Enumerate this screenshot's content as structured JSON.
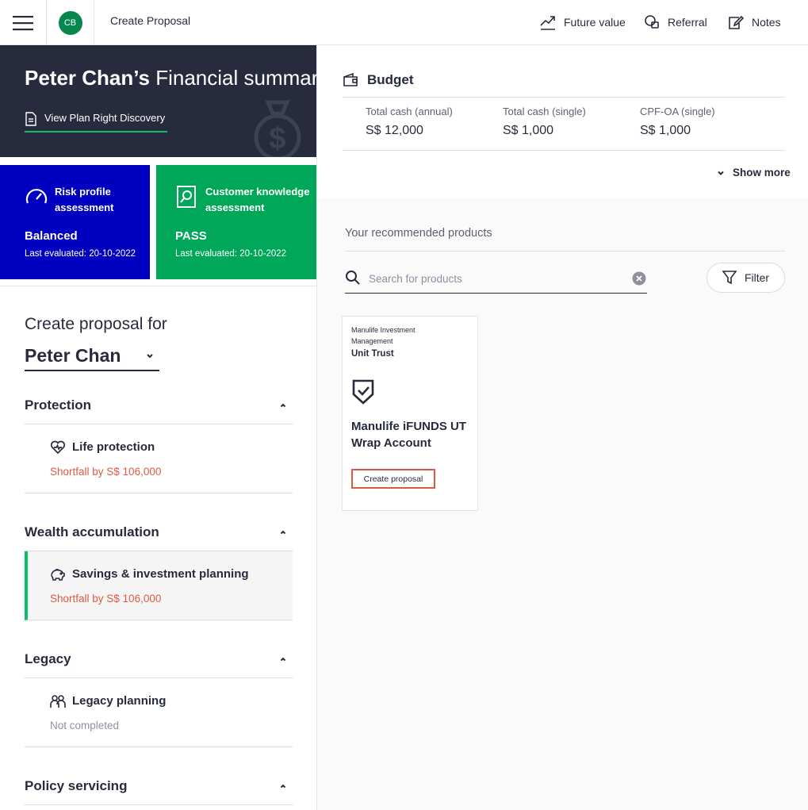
{
  "header": {
    "avatar_initials": "CB",
    "page_title": "Create Proposal",
    "actions": [
      {
        "label": "Future value",
        "icon": "trend-up-icon"
      },
      {
        "label": "Referral",
        "icon": "referral-icon"
      },
      {
        "label": "Notes",
        "icon": "notes-icon"
      }
    ]
  },
  "summary": {
    "name": "Peter Chan’s",
    "title_rest": "Financial summary",
    "view_link": "View Plan Right Discovery"
  },
  "assessments": {
    "risk": {
      "title": "Risk profile assessment",
      "value": "Balanced",
      "date": "Last evaluated: 20-10-2022",
      "color": "#0000c1"
    },
    "ck": {
      "title": "Customer knowledge assessment",
      "value": "PASS",
      "date": "Last evaluated: 20-10-2022",
      "color": "#00a758"
    }
  },
  "proposal": {
    "label": "Create proposal for",
    "client": "Peter Chan"
  },
  "categories": [
    {
      "title": "Protection",
      "item": "Life protection",
      "status": "Shortfall by S$ 106,000",
      "icon": "heart-icon"
    },
    {
      "title": "Wealth accumulation",
      "item": "Savings & investment planning",
      "status": "Shortfall by S$ 106,000",
      "icon": "piggy-bank-icon"
    },
    {
      "title": "Legacy",
      "item": "Legacy planning",
      "status": "Not completed",
      "icon": "family-icon"
    },
    {
      "title": "Policy servicing"
    }
  ],
  "budget": {
    "title": "Budget",
    "columns": [
      {
        "label": "Total cash (annual)",
        "value": "S$ 12,000"
      },
      {
        "label": "Total cash (single)",
        "value": "S$ 1,000"
      },
      {
        "label": "CPF-OA (single)",
        "value": "S$ 1,000"
      }
    ],
    "show_more": "Show more"
  },
  "products": {
    "heading": "Your recommended products",
    "search_placeholder": "Search for products",
    "filter_label": "Filter",
    "items": [
      {
        "provider": "Manulife Investment Management",
        "type": "Unit Trust",
        "name": "Manulife iFUNDS UT Wrap Account",
        "cta": "Create proposal"
      }
    ]
  }
}
